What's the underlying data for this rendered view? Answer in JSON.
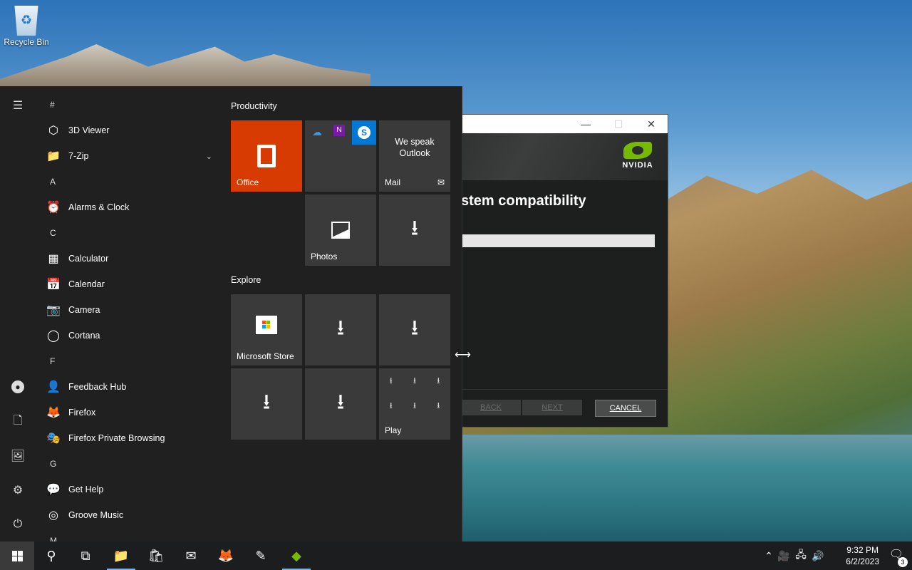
{
  "desktop": {
    "recycle_bin_label": "Recycle Bin"
  },
  "installer": {
    "brand": "NVIDIA",
    "heading": "stem compatibility",
    "buttons": {
      "back": "BACK",
      "next": "NEXT",
      "cancel": "CANCEL"
    },
    "window_controls": {
      "minimize": "—",
      "maximize": "☐",
      "close": "✕"
    }
  },
  "start_menu": {
    "rail_icons": [
      "hamburger-icon",
      "user-icon",
      "document-icon",
      "pictures-icon",
      "settings-icon",
      "power-icon"
    ],
    "apps": [
      {
        "type": "letter",
        "text": "#"
      },
      {
        "type": "app",
        "label": "3D Viewer",
        "icon": "cube-icon",
        "glyph": "⬡"
      },
      {
        "type": "app",
        "label": "7-Zip",
        "icon": "folder-icon",
        "glyph": "📁",
        "expandable": true
      },
      {
        "type": "letter",
        "text": "A"
      },
      {
        "type": "app",
        "label": "Alarms & Clock",
        "icon": "alarm-clock-icon",
        "glyph": "⏰"
      },
      {
        "type": "letter",
        "text": "C"
      },
      {
        "type": "app",
        "label": "Calculator",
        "icon": "calculator-icon",
        "glyph": "▦"
      },
      {
        "type": "app",
        "label": "Calendar",
        "icon": "calendar-icon",
        "glyph": "📅"
      },
      {
        "type": "app",
        "label": "Camera",
        "icon": "camera-icon",
        "glyph": "📷"
      },
      {
        "type": "app",
        "label": "Cortana",
        "icon": "cortana-icon",
        "glyph": "◯"
      },
      {
        "type": "letter",
        "text": "F"
      },
      {
        "type": "app",
        "label": "Feedback Hub",
        "icon": "feedback-hub-icon",
        "glyph": "👤"
      },
      {
        "type": "app",
        "label": "Firefox",
        "icon": "firefox-icon",
        "glyph": "🦊"
      },
      {
        "type": "app",
        "label": "Firefox Private Browsing",
        "icon": "firefox-private-icon",
        "glyph": "🎭"
      },
      {
        "type": "letter",
        "text": "G"
      },
      {
        "type": "app",
        "label": "Get Help",
        "icon": "get-help-icon",
        "glyph": "💬"
      },
      {
        "type": "app",
        "label": "Groove Music",
        "icon": "groove-music-icon",
        "glyph": "◎"
      },
      {
        "type": "letter",
        "text": "M"
      }
    ],
    "groups": {
      "productivity": "Productivity",
      "explore": "Explore"
    },
    "tiles": {
      "office": "Office",
      "mail_caption": "We speak Outlook",
      "mail": "Mail",
      "photos": "Photos",
      "microsoft_store": "Microsoft Store",
      "play": "Play"
    }
  },
  "taskbar": {
    "time": "9:32 PM",
    "date": "6/2/2023",
    "notification_count": "3"
  }
}
